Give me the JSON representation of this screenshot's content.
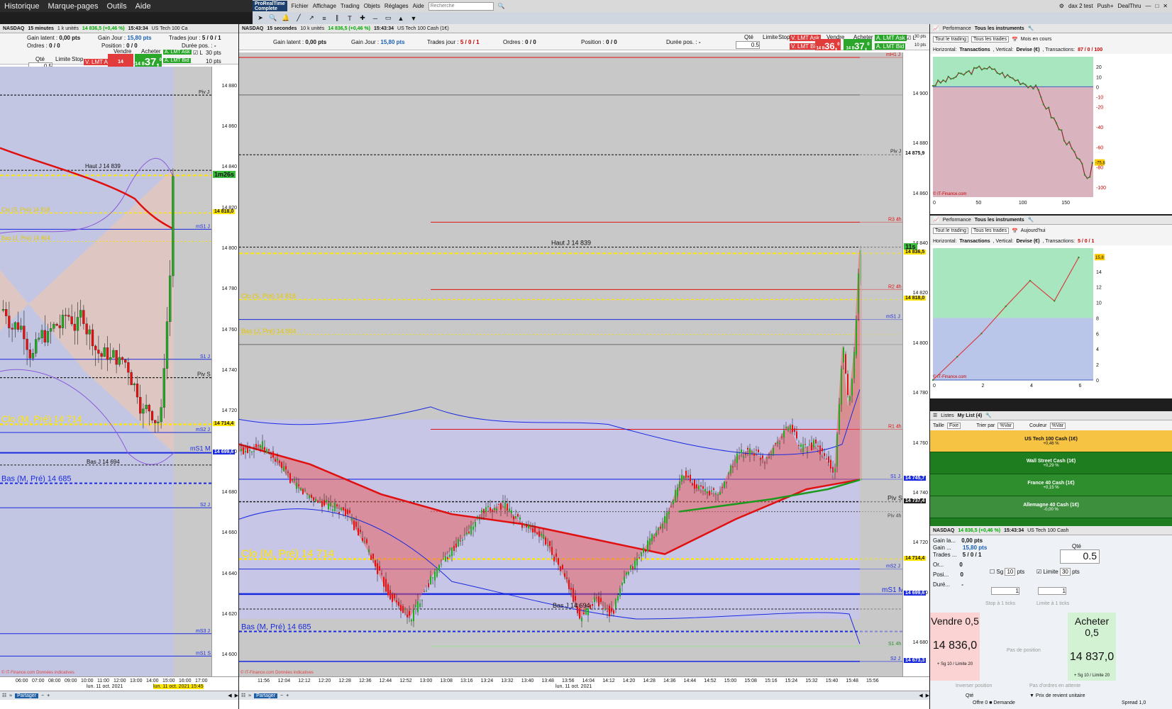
{
  "os_menu": [
    "Historique",
    "Marque-pages",
    "Outils",
    "Aide"
  ],
  "app": {
    "logo": "ProRealTime",
    "logo_sub": "Complete",
    "menu": [
      "Fichier",
      "Affichage",
      "Trading",
      "Objets",
      "Réglages",
      "Aide"
    ],
    "search_placeholder": "Recherche",
    "right_items": [
      "dax 2 test",
      "Push+",
      "DealThru"
    ]
  },
  "chart_left": {
    "header": {
      "symbol": "NASDAQ",
      "timeframe": "15 minutes",
      "units": "1 k unités",
      "price": "14 836,5 (+0,46 %)",
      "time": "15:43:34",
      "instrument": "US Tech 100 Ca"
    },
    "order": {
      "gain_latent_label": "Gain latent :",
      "gain_latent": "0,00 pts",
      "gain_jour_label": "Gain Jour :",
      "gain_jour": "15,80 pts",
      "trades_label": "Trades jour :",
      "trades": "5 / 0 / 1",
      "ordres_label": "Ordres :",
      "ordres": "0 / 0",
      "position_label": "Position :",
      "position": "0 / 0",
      "duree_label": "Durée pos. :",
      "duree": "-"
    },
    "qty_label": "Qté",
    "qty": "0.5",
    "limite": "Limite",
    "stop": "Stop",
    "v_ask": "V. LMT Ask",
    "v_bid": "V. LMT Bid",
    "a_ask": "A. LMT Ask",
    "a_bid": "A. LMT Bid",
    "vendre": "Vendre",
    "acheter": "Acheter",
    "sell_px_small": "14 8",
    "sell_px_big": "36,",
    "sell_px_sup": "0",
    "buy_px_small": "14 8",
    "buy_px_big": "37,",
    "buy_px_sup": "0",
    "l_label": "L",
    "pts30": "30 pts",
    "pts10": "10 pts",
    "countdown": "1m26s",
    "y_ticks": [
      "14 880",
      "14 860",
      "14 840",
      "14 820",
      "14 800",
      "14 780",
      "14 760",
      "14 740",
      "14 720",
      "14 700",
      "14 680",
      "14 660",
      "14 640",
      "14 620",
      "14 600"
    ],
    "tags": {
      "t1": "14 818,0",
      "t2": "14 714,4",
      "t3": "14 699,6"
    },
    "labels": {
      "piv_j": "Piv J",
      "haut": "Haut J 14 839",
      "clo_s": "Clo (S, Pré) 14 818",
      "bas_j_pre": "Bas (J, Pré) 14 804",
      "ms1j": "mS1 J",
      "s1j": "S1 J",
      "piv_s": "Piv S",
      "clo_m": "Clo (M, Pré) 14 714",
      "ms2j": "mS2 J",
      "ms1m": "mS1 M",
      "bas_j": "Bas J 14 694",
      "bas_m": "Bas (M, Pré) 14 685",
      "s2j": "S2 J",
      "ms3j": "mS3 J",
      "ms1s": "mS1 S"
    },
    "x_ticks": [
      "06:00",
      "07:00",
      "08:00",
      "09:00",
      "10:00",
      "11:00",
      "12:00",
      "13:00",
      "14:00",
      "15:00",
      "16:00",
      "17:00"
    ],
    "x_date": "lun. 11 oct. 2021",
    "x_cursor": "lun. 11 oct. 2021 15:45",
    "footer": "© IT-Finance.com Données indicatives",
    "share": "Partager"
  },
  "chart_main": {
    "header": {
      "symbol": "NASDAQ",
      "timeframe": "15 secondes",
      "units": "10 k unités",
      "price": "14 836,5 (+0,46 %)",
      "time": "15:43:34",
      "instrument": "US Tech 100 Cash (1€)"
    },
    "order": {
      "gain_latent_label": "Gain latent :",
      "gain_latent": "0,00 pts",
      "gain_jour_label": "Gain Jour :",
      "gain_jour": "15,80 pts",
      "trades_label": "Trades jour :",
      "trades": "5 / 0 / 1",
      "ordres_label": "Ordres :",
      "ordres": "0 / 0",
      "position_label": "Position :",
      "position": "0 / 0",
      "duree_label": "Durée pos. :",
      "duree": "-"
    },
    "countdown": "11s",
    "y_ticks": [
      "14 900",
      "14 880",
      "14 860",
      "14 840",
      "14 820",
      "14 800",
      "14 780",
      "14 760",
      "14 740",
      "14 720",
      "14 700",
      "14 680"
    ],
    "tags": {
      "t0": "14 875,9",
      "t1": "14 836,5",
      "t2": "14 818,0",
      "t3": "14 745,7",
      "t4": "14 737,4",
      "t5": "14 714,4",
      "t6": "14 699,6",
      "t7": "14 673,3"
    },
    "labels": {
      "mh1j": "mH1 J",
      "piv_j": "Piv J",
      "r3": "R3 4h",
      "haut": "Haut J 14 839",
      "r2": "R2 4h",
      "clo_s": "Clo (S, Pré) 14 818",
      "ms1j": "mS1 J",
      "bas_j_pre": "Bas (J, Pré) 14 804",
      "r1": "R1 4h",
      "s1j": "S1 J",
      "piv_s": "Piv S",
      "piv4": "Piv 4h",
      "clo_m": "Clo (M, Pré) 14 714",
      "ms2j": "mS2 J",
      "ms1m": "mS1 M",
      "bas_j": "Bas J 14 694",
      "bas_m": "Bas (M, Pré) 14 685",
      "s14": "S1 4h",
      "s2j": "S2 J"
    },
    "x_ticks": [
      "11:56",
      "12:04",
      "12:12",
      "12:20",
      "12:28",
      "12:36",
      "12:44",
      "12:52",
      "13:00",
      "13:08",
      "13:16",
      "13:24",
      "13:32",
      "13:40",
      "13:48",
      "13:56",
      "14:04",
      "14:12",
      "14:20",
      "14:28",
      "14:36",
      "14:44",
      "14:52",
      "15:00",
      "15:08",
      "15:16",
      "15:24",
      "15:32",
      "15:40",
      "15:48",
      "15:56"
    ],
    "x_date": "lun. 11 oct. 2021",
    "footer": "© IT-Finance.com Données indicatives"
  },
  "perf1": {
    "title": "Performance",
    "scope": "Tous les instruments",
    "f1": "Tout le trading",
    "f2": "Tous les trades",
    "period": "Mois en cours",
    "caption_a": "Horizontal:",
    "caption_b": "Transactions",
    "caption_c": ", Vertical:",
    "caption_d": "Devise (€)",
    "caption_e": ", Transactions:",
    "caption_f": "87 / 0 / 100",
    "y_ticks": [
      "20",
      "10",
      "0",
      "-10",
      "-20",
      "-40",
      "-60",
      "-80",
      "-100"
    ],
    "current": "-75,8",
    "x_ticks": [
      "0",
      "50",
      "100",
      "150"
    ],
    "footer": "© IT-Finance.com"
  },
  "perf2": {
    "title": "Performance",
    "scope": "Tous les instruments",
    "f1": "Tout le trading",
    "f2": "Tous les trades",
    "period": "Aujourd'hui",
    "caption_a": "Horizontal:",
    "caption_b": "Transactions",
    "caption_c": ", Vertical:",
    "caption_d": "Devise (€)",
    "caption_e": ", Transactions:",
    "caption_f": "5 / 0 / 1",
    "y_ticks": [
      "16",
      "14",
      "12",
      "10",
      "8",
      "6",
      "4",
      "2",
      "0"
    ],
    "current": "15,8",
    "x_ticks": [
      "0",
      "2",
      "4",
      "6"
    ],
    "footer": "© IT-Finance.com"
  },
  "watchlist": {
    "title": "Listes",
    "list": "My List (4)",
    "taille_label": "Taille",
    "taille": "Fixe",
    "trier_label": "Trier par",
    "trier": "%Var",
    "couleur_label": "Couleur",
    "couleur": "%Var",
    "items": [
      {
        "name": "US Tech 100 Cash (1€)",
        "change": "+0,46 %",
        "color": "#f6c342",
        "text": "#111"
      },
      {
        "name": "Wall Street Cash (1€)",
        "change": "+0,29 %",
        "color": "#1e7d1e",
        "text": "#fff"
      },
      {
        "name": "France 40 Cash (1€)",
        "change": "+0,15 %",
        "color": "#2e8e2e",
        "text": "#fff"
      },
      {
        "name": "Allemagne 40 Cash (1€)",
        "change": "-0,00 %",
        "color": "#3d8f3d",
        "text": "#fff"
      }
    ]
  },
  "ticket": {
    "header": {
      "symbol": "NASDAQ",
      "price": "14 836,5 (+0,46 %)",
      "time": "15:43:34",
      "instrument": "US Tech 100 Cash"
    },
    "gain_latent_label": "Gain la...",
    "gain_latent": "0,00 pts",
    "gain_label": "Gain ...",
    "gain": "15,80 pts",
    "trades_label": "Trades ...",
    "trades": "5 / 0 / 1",
    "ordres_label": "Or...",
    "ordres": "0",
    "posi_label": "Posi...",
    "posi": "0",
    "duree_label": "Duré...",
    "duree": "-",
    "qty_label": "Qté",
    "qty": "0.5",
    "sg_label": "Sg",
    "sg": "10",
    "pts": "pts",
    "limite_label": "Limite",
    "limite": "30",
    "stepper1": "1",
    "stepper2": "1",
    "stop_ticks": "Stop à 1 ticks",
    "limit_ticks": "Limite à 1 ticks",
    "sell_label": "Vendre 0,5",
    "sell_px": "14 836,0",
    "sell_sub": "+ Sg 10 / Limite 20",
    "no_position": "Pas de position",
    "buy_label": "Acheter 0,5",
    "buy_px": "14 837,0",
    "buy_sub": "+ Sg 10 / Limite 20",
    "inverser": "Inverser position",
    "no_orders": "Pas d'ordres en attente",
    "col_qte": "Qté",
    "col_prix": "Prix de revient unitaire",
    "offre": "Offre",
    "offre_val": "0",
    "demande": "Demande",
    "spread_label": "Spread",
    "spread": "1,0"
  }
}
